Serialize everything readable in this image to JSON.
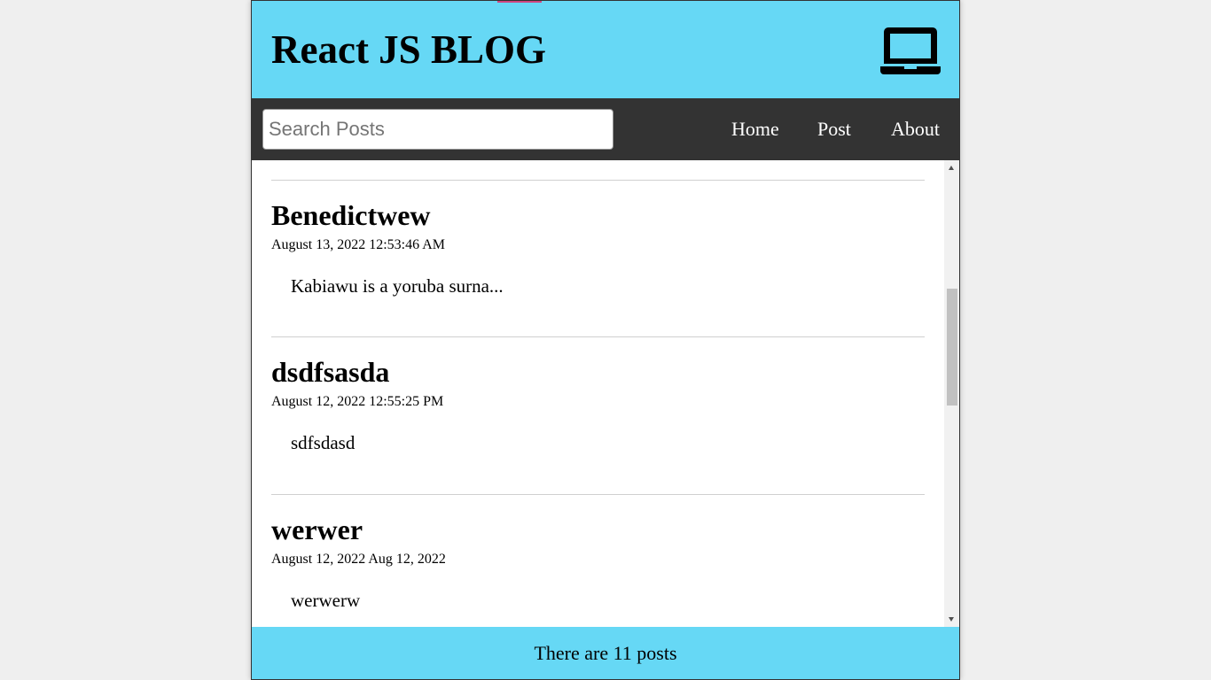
{
  "header": {
    "title": "React JS BLOG",
    "icon": "laptop-icon",
    "background": "#66d8f5"
  },
  "nav": {
    "search_placeholder": "Search Posts",
    "search_value": "",
    "links": [
      "Home",
      "Post",
      "About"
    ],
    "background": "#333333"
  },
  "posts": [
    {
      "title": "Benedictwew",
      "date": "August 13, 2022 12:53:46 AM",
      "body": "Kabiawu is a yoruba surna..."
    },
    {
      "title": "dsdfsasda",
      "date": "August 12, 2022 12:55:25 PM",
      "body": "sdfsdasd"
    },
    {
      "title": "werwer",
      "date": "August 12, 2022 Aug 12, 2022",
      "body": "werwerw"
    }
  ],
  "footer": {
    "text": "There are 11 posts"
  }
}
